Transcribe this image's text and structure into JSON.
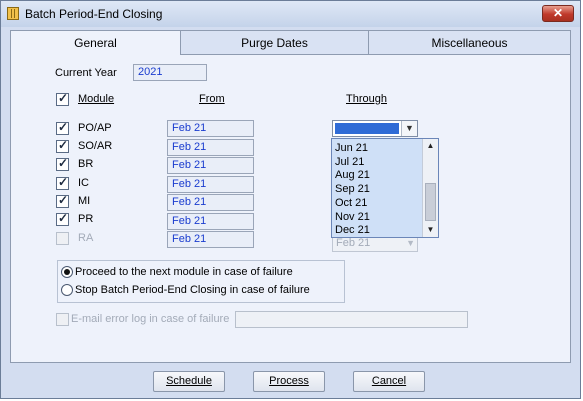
{
  "window": {
    "title": "Batch Period-End Closing",
    "close_glyph": "✕"
  },
  "tabs": [
    "General",
    "Purge Dates",
    "Miscellaneous"
  ],
  "current_year": {
    "label": "Current Year",
    "value": "2021"
  },
  "headers": {
    "module": "Module",
    "from": "From",
    "through": "Through"
  },
  "modules": [
    {
      "name": "PO/AP",
      "checked": true,
      "enabled": true,
      "from": "Feb 21"
    },
    {
      "name": "SO/AR",
      "checked": true,
      "enabled": true,
      "from": "Feb 21"
    },
    {
      "name": "BR",
      "checked": true,
      "enabled": true,
      "from": "Feb 21"
    },
    {
      "name": "IC",
      "checked": true,
      "enabled": true,
      "from": "Feb 21"
    },
    {
      "name": "MI",
      "checked": true,
      "enabled": true,
      "from": "Feb 21"
    },
    {
      "name": "PR",
      "checked": true,
      "enabled": true,
      "from": "Feb 21"
    },
    {
      "name": "RA",
      "checked": false,
      "enabled": false,
      "from": "Feb 21"
    }
  ],
  "through_dropdown": {
    "options": [
      "Jun 21",
      "Jul 21",
      "Aug 21",
      "Sep 21",
      "Oct 21",
      "Nov 21",
      "Dec 21"
    ]
  },
  "ra_through": "Feb 21",
  "failure_options": {
    "proceed": "Proceed to the next module in case of failure",
    "stop": "Stop Batch Period-End Closing in case of failure",
    "selected": "proceed"
  },
  "email_log": {
    "label": "E-mail error log in case of failure",
    "checked": false,
    "value": ""
  },
  "buttons": {
    "schedule": "Schedule",
    "process": "Process",
    "cancel": "Cancel"
  },
  "colors": {
    "selection": "#2f6bd6",
    "field_text": "#1a3ccf",
    "dropdown_bg": "#cfe0f7"
  }
}
